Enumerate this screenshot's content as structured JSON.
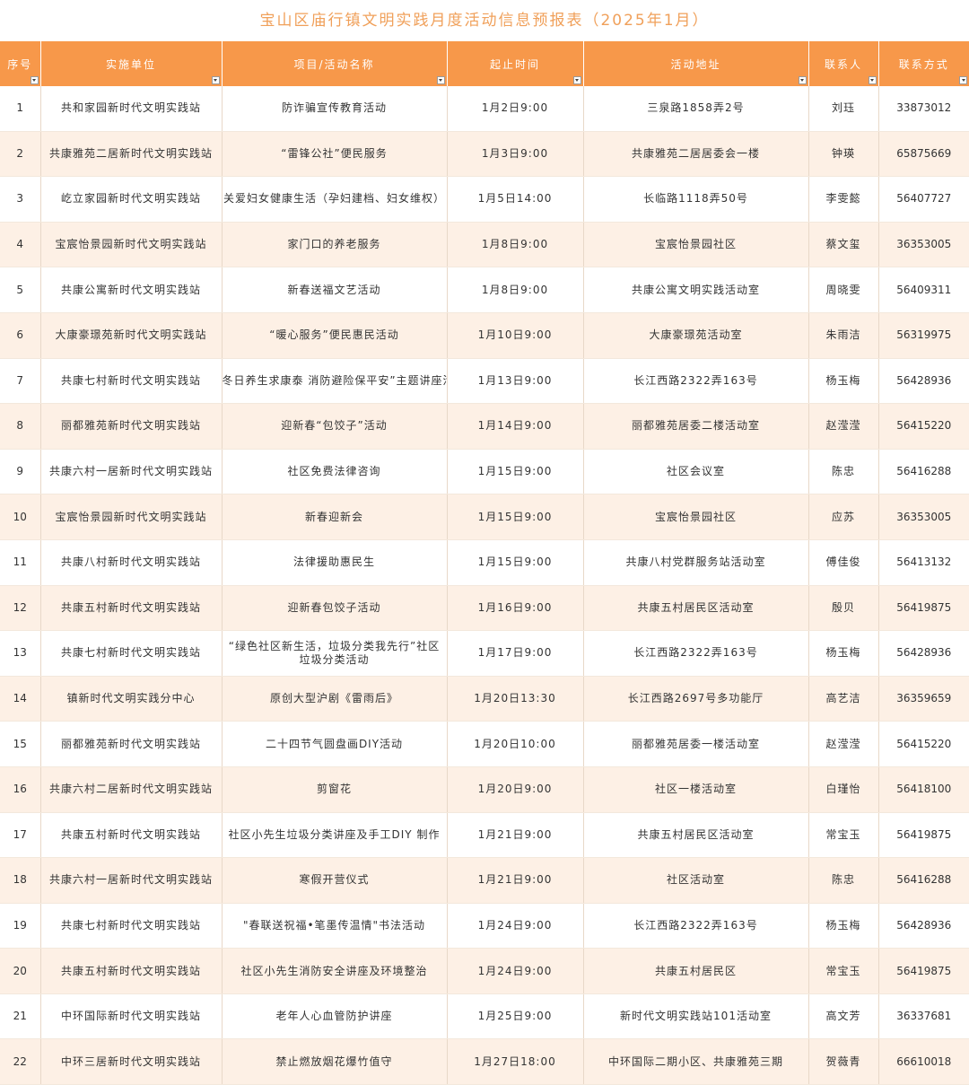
{
  "title": "宝山区庙行镇文明实践月度活动信息预报表（2025年1月）",
  "columns": [
    "序号",
    "实施单位",
    "项目/活动名称",
    "起止时间",
    "活动地址",
    "联系人",
    "联系方式"
  ],
  "rows": [
    [
      "1",
      "共和家园新时代文明实践站",
      "防诈骗宣传教育活动",
      "1月2日9:00",
      "三泉路1858弄2号",
      "刘珏",
      "33873012"
    ],
    [
      "2",
      "共康雅苑二居新时代文明实践站",
      "“雷锋公社”便民服务",
      "1月3日9:00",
      "共康雅苑二居居委会一楼",
      "钟瑛",
      "65875669"
    ],
    [
      "3",
      "屹立家园新时代文明实践站",
      "关爱妇女健康生活（孕妇建档、妇女维权）",
      "1月5日14:00",
      "长临路1118弄50号",
      "李雯懿",
      "56407727"
    ],
    [
      "4",
      "宝宸怡景园新时代文明实践站",
      "家门口的养老服务",
      "1月8日9:00",
      "宝宸怡景园社区",
      "蔡文玺",
      "36353005"
    ],
    [
      "5",
      "共康公寓新时代文明实践站",
      "新春送福文艺活动",
      "1月8日9:00",
      "共康公寓文明实践活动室",
      "周晓雯",
      "56409311"
    ],
    [
      "6",
      "大康豪璟苑新时代文明实践站",
      "“暖心服务”便民惠民活动",
      "1月10日9:00",
      "大康豪璟苑活动室",
      "朱雨洁",
      "56319975"
    ],
    [
      "7",
      "共康七村新时代文明实践站",
      "冬日养生求康泰 消防避险保平安”主题讲座活",
      "1月13日9:00",
      "长江西路2322弄163号",
      "杨玉梅",
      "56428936"
    ],
    [
      "8",
      "丽都雅苑新时代文明实践站",
      "迎新春“包饺子”活动",
      "1月14日9:00",
      "丽都雅苑居委二楼活动室",
      "赵滢滢",
      "56415220"
    ],
    [
      "9",
      "共康六村一居新时代文明实践站",
      "社区免费法律咨询",
      "1月15日9:00",
      "社区会议室",
      "陈忠",
      "56416288"
    ],
    [
      "10",
      "宝宸怡景园新时代文明实践站",
      "新春迎新会",
      "1月15日9:00",
      "宝宸怡景园社区",
      "应苏",
      "36353005"
    ],
    [
      "11",
      "共康八村新时代文明实践站",
      "法律援助惠民生",
      "1月15日9:00",
      "共康八村党群服务站活动室",
      "傅佳俊",
      "56413132"
    ],
    [
      "12",
      "共康五村新时代文明实践站",
      "迎新春包饺子活动",
      "1月16日9:00",
      "共康五村居民区活动室",
      "殷贝",
      "56419875"
    ],
    [
      "13",
      "共康七村新时代文明实践站",
      "“绿色社区新生活，垃圾分类我先行”社区垃圾分类活动",
      "1月17日9:00",
      "长江西路2322弄163号",
      "杨玉梅",
      "56428936"
    ],
    [
      "14",
      "镇新时代文明实践分中心",
      "原创大型沪剧《雷雨后》",
      "1月20日13:30",
      "长江西路2697号多功能厅",
      "高艺洁",
      "36359659"
    ],
    [
      "15",
      "丽都雅苑新时代文明实践站",
      "二十四节气圆盘画DIY活动",
      "1月20日10:00",
      "丽都雅苑居委一楼活动室",
      "赵滢滢",
      "56415220"
    ],
    [
      "16",
      "共康六村二居新时代文明实践站",
      "剪窗花",
      "1月20日9:00",
      "社区一楼活动室",
      "白瑾怡",
      "56418100"
    ],
    [
      "17",
      "共康五村新时代文明实践站",
      "社区小先生垃圾分类讲座及手工DIY 制作",
      "1月21日9:00",
      "共康五村居民区活动室",
      "常宝玉",
      "56419875"
    ],
    [
      "18",
      "共康六村一居新时代文明实践站",
      "寒假开营仪式",
      "1月21日9:00",
      "社区活动室",
      "陈忠",
      "56416288"
    ],
    [
      "19",
      "共康七村新时代文明实践站",
      "\"春联送祝福•笔墨传温情\"书法活动",
      "1月24日9:00",
      "长江西路2322弄163号",
      "杨玉梅",
      "56428936"
    ],
    [
      "20",
      "共康五村新时代文明实践站",
      "社区小先生消防安全讲座及环境整治",
      "1月24日9:00",
      "共康五村居民区",
      "常宝玉",
      "56419875"
    ],
    [
      "21",
      "中环国际新时代文明实践站",
      "老年人心血管防护讲座",
      "1月25日9:00",
      "新时代文明实践站101活动室",
      "高文芳",
      "36337681"
    ],
    [
      "22",
      "中环三居新时代文明实践站",
      "禁止燃放烟花爆竹值守",
      "1月27日18:00",
      "中环国际二期小区、共康雅苑三期",
      "贺薇青",
      "66610018"
    ]
  ],
  "colors": {
    "header_bg": "#f7984a",
    "title": "#f0a05a",
    "stripe": "#fdf0e5"
  },
  "icons": {
    "filter": "dropdown-filter-icon"
  }
}
